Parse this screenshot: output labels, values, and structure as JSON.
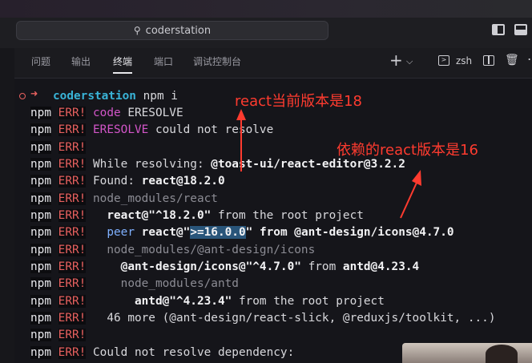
{
  "search": {
    "icon": "search-icon",
    "value": "coderstation"
  },
  "panel": {
    "tabs": [
      "问题",
      "输出",
      "终端",
      "端口",
      "调试控制台"
    ],
    "active_tab": "终端",
    "add_label": "+",
    "dropdown_label": "⌵",
    "shell": "zsh"
  },
  "terminal": {
    "prompt_dir": "coderstation",
    "prompt_cmd": " npm i",
    "npm": "npm",
    "err": "ERR!",
    "lines": {
      "l1_a": "code",
      "l1_b": " ERESOLVE",
      "l2_a": "ERESOLVE",
      "l2_b": " could not resolve",
      "l4": "While resolving: ",
      "l4_b": "@toast-ui/react-editor@3.2.2",
      "l5": "Found: ",
      "l5_b": "react@18.2.0",
      "l6": "node_modules/react",
      "l7_a": "  react@\"^18.2.0\"",
      "l7_b": " from the root project",
      "l8_a": "  peer ",
      "l8_b": "react@\"",
      "l8_sel": ">=16.0.0",
      "l8_c": "\" from ",
      "l8_d": "@ant-design/icons@4.7.0",
      "l9": "  node_modules/@ant-design/icons",
      "l10_a": "    @ant-design/icons@\"^4.7.0\"",
      "l10_b": " from ",
      "l10_c": "antd@4.23.4",
      "l11": "    node_modules/antd",
      "l12_a": "      antd@\"^4.23.4\"",
      "l12_b": " from the root project",
      "l13": "  46 more (@ant-design/react-slick, @reduxjs/toolkit, ...)",
      "l15": "Could not resolve dependency:"
    }
  },
  "annotations": {
    "current": "react当前版本是18",
    "dependency": "依赖的react版本是16"
  },
  "colors": {
    "annotation": "#ff3b2f",
    "error": "#e8615f",
    "prompt": "#39b3d7",
    "selection": "#29557a"
  }
}
